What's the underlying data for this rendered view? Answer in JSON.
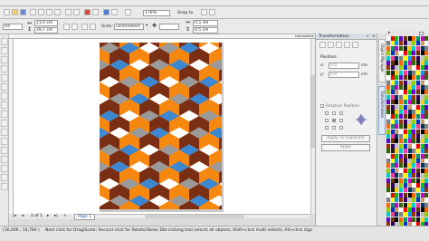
{
  "toolbar": {
    "zoom_value": "176%",
    "snap_to_label": "Snap to",
    "units_label": "Units:",
    "units_value": "centimeters",
    "width_value": "21,0 cm",
    "height_value": "29,7 cm",
    "nudge_x": "0,5 cm",
    "nudge_y": "0,5 cm",
    "page_size": "A4"
  },
  "docker": {
    "title": "Transformation",
    "position_label": "Position:",
    "x_value": "0,0",
    "y_value": "0,0",
    "unit": "cm",
    "relative_position_label": "Relative Position",
    "apply_to_duplicate_label": "Apply To Duplicate",
    "apply_label": "Apply",
    "side_tab_1": "Object Manager",
    "side_tab_2": "Transformation"
  },
  "page_nav": {
    "current": "1 of 1",
    "page_tab": "Page 1"
  },
  "status": {
    "coords": "(16,006 ; 14,780 )",
    "hint": "Next click for Drag/Scale; Second click for Rotate/Skew; Dbl-clicking tool selects all objects; Shift+click multi-selects; Alt+click digs"
  },
  "ruler_labels": [
    "centimeters"
  ],
  "colors": {
    "orange": "#f7880f",
    "blue": "#3b87d2",
    "gray": "#9a9a9a",
    "brown": "#7a2e14",
    "white": "#ffffff"
  }
}
